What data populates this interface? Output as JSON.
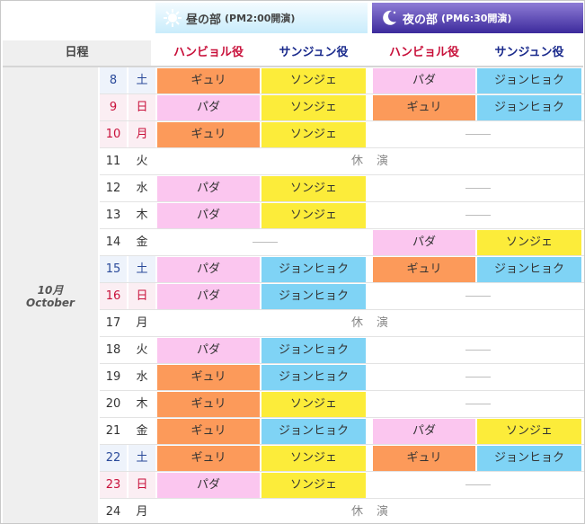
{
  "header": {
    "day_title": "昼の部",
    "day_time": "(PM2:00開演)",
    "night_title": "夜の部",
    "night_time": "(PM6:30開演)",
    "schedule_label": "日程",
    "role_han": "ハンビョル役",
    "role_san": "サンジュン役"
  },
  "month": {
    "jp": "10月",
    "en": "October"
  },
  "rest": {
    "a": "休",
    "b": "演"
  },
  "dash": "——",
  "colors": {
    "pink": "#fbc6ef",
    "orange": "#fc9a5a",
    "yellow": "#fcec3a",
    "blue": "#7fd3f5",
    "night_band": "#3c2a9c",
    "day_band": "#c9ecfb"
  },
  "icons": {
    "day": "sun-icon",
    "night": "moon-icon"
  },
  "rows": [
    {
      "d": "8",
      "w": "土",
      "t": "sa",
      "day": [
        [
          "ギュリ",
          "or"
        ],
        [
          "ソンジェ",
          "ye"
        ]
      ],
      "night": [
        [
          "パダ",
          "pk"
        ],
        [
          "ジョンヒョク",
          "bl"
        ]
      ]
    },
    {
      "d": "9",
      "w": "日",
      "t": "su",
      "day": [
        [
          "パダ",
          "pk"
        ],
        [
          "ソンジェ",
          "ye"
        ]
      ],
      "night": [
        [
          "ギュリ",
          "or"
        ],
        [
          "ジョンヒョク",
          "bl"
        ]
      ]
    },
    {
      "d": "10",
      "w": "月",
      "t": "su",
      "day": [
        [
          "ギュリ",
          "or"
        ],
        [
          "ソンジェ",
          "ye"
        ]
      ],
      "night": "dash"
    },
    {
      "d": "11",
      "w": "火",
      "t": "wk",
      "rest": true
    },
    {
      "d": "12",
      "w": "水",
      "t": "wk",
      "day": [
        [
          "パダ",
          "pk"
        ],
        [
          "ソンジェ",
          "ye"
        ]
      ],
      "night": "dash"
    },
    {
      "d": "13",
      "w": "木",
      "t": "wk",
      "day": [
        [
          "パダ",
          "pk"
        ],
        [
          "ソンジェ",
          "ye"
        ]
      ],
      "night": "dash"
    },
    {
      "d": "14",
      "w": "金",
      "t": "wk",
      "day": "dash",
      "night": [
        [
          "パダ",
          "pk"
        ],
        [
          "ソンジェ",
          "ye"
        ]
      ]
    },
    {
      "d": "15",
      "w": "土",
      "t": "sa",
      "day": [
        [
          "パダ",
          "pk"
        ],
        [
          "ジョンヒョク",
          "bl"
        ]
      ],
      "night": [
        [
          "ギュリ",
          "or"
        ],
        [
          "ジョンヒョク",
          "bl"
        ]
      ]
    },
    {
      "d": "16",
      "w": "日",
      "t": "su",
      "day": [
        [
          "パダ",
          "pk"
        ],
        [
          "ジョンヒョク",
          "bl"
        ]
      ],
      "night": "dash"
    },
    {
      "d": "17",
      "w": "月",
      "t": "wk",
      "rest": true
    },
    {
      "d": "18",
      "w": "火",
      "t": "wk",
      "day": [
        [
          "パダ",
          "pk"
        ],
        [
          "ジョンヒョク",
          "bl"
        ]
      ],
      "night": "dash"
    },
    {
      "d": "19",
      "w": "水",
      "t": "wk",
      "day": [
        [
          "ギュリ",
          "or"
        ],
        [
          "ジョンヒョク",
          "bl"
        ]
      ],
      "night": "dash"
    },
    {
      "d": "20",
      "w": "木",
      "t": "wk",
      "day": [
        [
          "ギュリ",
          "or"
        ],
        [
          "ソンジェ",
          "ye"
        ]
      ],
      "night": "dash"
    },
    {
      "d": "21",
      "w": "金",
      "t": "wk",
      "day": [
        [
          "ギュリ",
          "or"
        ],
        [
          "ジョンヒョク",
          "bl"
        ]
      ],
      "night": [
        [
          "パダ",
          "pk"
        ],
        [
          "ソンジェ",
          "ye"
        ]
      ]
    },
    {
      "d": "22",
      "w": "土",
      "t": "sa",
      "day": [
        [
          "ギュリ",
          "or"
        ],
        [
          "ソンジェ",
          "ye"
        ]
      ],
      "night": [
        [
          "ギュリ",
          "or"
        ],
        [
          "ジョンヒョク",
          "bl"
        ]
      ]
    },
    {
      "d": "23",
      "w": "日",
      "t": "su",
      "day": [
        [
          "パダ",
          "pk"
        ],
        [
          "ソンジェ",
          "ye"
        ]
      ],
      "night": "dash"
    },
    {
      "d": "24",
      "w": "月",
      "t": "wk",
      "rest": true
    }
  ]
}
